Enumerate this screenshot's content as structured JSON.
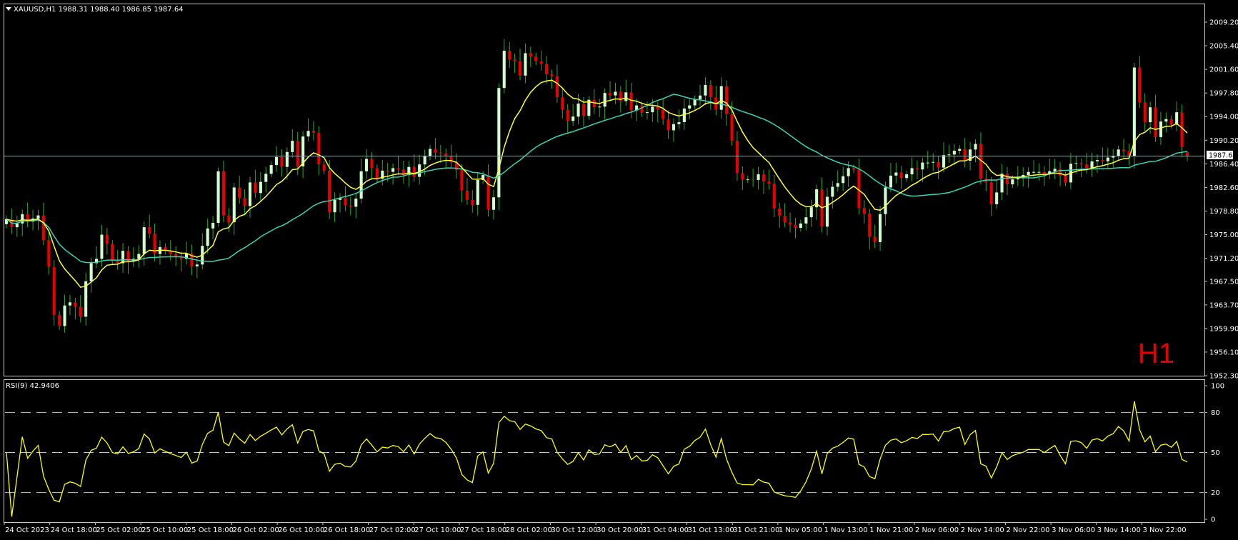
{
  "header": {
    "symbol_line": "XAUUSD,H1  1988.31 1988.40 1986.85 1987.64",
    "rsi_line": "RSI(9) 42.9406",
    "timeframe_badge": "H1",
    "current_price_label": "1987.64"
  },
  "colors": {
    "background": "#000000",
    "frame": "#c8c8c8",
    "bull_candle": "#d0ffd0",
    "bear_candle": "#e60000",
    "wick": "#2eaa2e",
    "fast_ma": "#ffff33",
    "slow_ma": "#33d6b4",
    "rsi_line": "#ffff00",
    "badge": "#e60000",
    "price_line": "#8fa3a3"
  },
  "chart_data": [
    {
      "type": "candlestick",
      "title": "XAUUSD,H1",
      "symbol": "XAUUSD",
      "timeframe": "H1",
      "last_bar": {
        "open": 1988.31,
        "high": 1988.4,
        "low": 1986.85,
        "close": 1987.64
      },
      "ylim": [
        1952.3,
        2011.5
      ],
      "y_ticks": [
        "2009.20",
        "2005.40",
        "2001.60",
        "1997.80",
        "1994.00",
        "1990.20",
        "1986.40",
        "1982.60",
        "1978.80",
        "1975.00",
        "1971.20",
        "1967.50",
        "1963.70",
        "1959.90",
        "1956.10",
        "1952.30"
      ],
      "x_ticks": [
        "24 Oct 2023",
        "24 Oct 18:00",
        "25 Oct 02:00",
        "25 Oct 10:00",
        "25 Oct 18:00",
        "26 Oct 02:00",
        "26 Oct 10:00",
        "26 Oct 18:00",
        "27 Oct 02:00",
        "27 Oct 10:00",
        "27 Oct 18:00",
        "28 Oct 02:00",
        "30 Oct 12:00",
        "30 Oct 20:00",
        "31 Oct 04:00",
        "31 Oct 13:00",
        "31 Oct 21:00",
        "1 Nov 05:00",
        "1 Nov 13:00",
        "1 Nov 21:00",
        "2 Nov 06:00",
        "2 Nov 14:00",
        "2 Nov 22:00",
        "3 Nov 06:00",
        "3 Nov 14:00",
        "3 Nov 22:00"
      ],
      "close": [
        1977.5,
        1976.2,
        1976.8,
        1978.3,
        1977.1,
        1977.6,
        1978.1,
        1974.1,
        1969.8,
        1962.1,
        1960.3,
        1963.6,
        1964.1,
        1963.4,
        1961.8,
        1967.5,
        1970.4,
        1971.1,
        1975.0,
        1973.5,
        1970.8,
        1970.4,
        1972.4,
        1970.7,
        1971.1,
        1971.9,
        1976.2,
        1975.2,
        1971.9,
        1973.0,
        1972.4,
        1971.9,
        1971.5,
        1971.1,
        1972.0,
        1969.9,
        1970.2,
        1973.2,
        1976.0,
        1976.9,
        1985.2,
        1978.1,
        1977.0,
        1982.6,
        1980.9,
        1979.6,
        1983.4,
        1981.7,
        1983.5,
        1984.8,
        1986.2,
        1987.5,
        1985.9,
        1988.3,
        1990.1,
        1986.0,
        1990.8,
        1991.7,
        1991.4,
        1986.3,
        1985.3,
        1978.6,
        1980.6,
        1980.9,
        1979.7,
        1979.5,
        1980.8,
        1985.2,
        1987.2,
        1985.7,
        1984.0,
        1985.3,
        1985.1,
        1985.7,
        1985.5,
        1984.6,
        1985.9,
        1984.3,
        1986.3,
        1987.6,
        1988.8,
        1988.2,
        1988.1,
        1987.6,
        1986.7,
        1985.4,
        1982.1,
        1980.6,
        1979.8,
        1983.8,
        1984.6,
        1979.0,
        1981.0,
        1998.6,
        2004.6,
        2003.2,
        2002.9,
        2000.6,
        2004.2,
        2003.7,
        2002.9,
        2002.5,
        2000.8,
        2000.5,
        1997.1,
        1995.1,
        1993.3,
        1994.0,
        1996.1,
        1994.1,
        1996.7,
        1995.5,
        1995.6,
        1997.8,
        1997.4,
        1998.0,
        1996.5,
        1997.9,
        1995.0,
        1995.8,
        1994.6,
        1994.7,
        1995.6,
        1995.1,
        1993.6,
        1991.8,
        1992.8,
        1993.1,
        1995.3,
        1995.8,
        1996.8,
        1997.4,
        1999.1,
        1997.1,
        1995.1,
        1998.9,
        1994.4,
        1990.1,
        1984.9,
        1983.9,
        1983.9,
        1983.8,
        1984.7,
        1983.6,
        1983.2,
        1979.2,
        1978.0,
        1977.0,
        1976.6,
        1976.1,
        1976.8,
        1977.8,
        1979.4,
        1982.3,
        1976.3,
        1981.1,
        1982.7,
        1983.3,
        1984.4,
        1985.7,
        1985.5,
        1979.3,
        1978.4,
        1974.7,
        1973.8,
        1978.3,
        1982.6,
        1984.5,
        1985.0,
        1984.1,
        1984.7,
        1985.7,
        1985.5,
        1986.6,
        1986.6,
        1986.7,
        1985.8,
        1987.8,
        1987.9,
        1988.5,
        1988.8,
        1986.9,
        1988.7,
        1989.6,
        1984.0,
        1983.4,
        1979.9,
        1981.8,
        1984.8,
        1983.1,
        1983.9,
        1984.3,
        1984.6,
        1985.1,
        1985.1,
        1985.1,
        1984.7,
        1985.2,
        1985.6,
        1984.5,
        1983.4,
        1986.4,
        1986.5,
        1986.3,
        1985.7,
        1986.8,
        1987.0,
        1986.8,
        1987.4,
        1987.7,
        1988.7,
        1988.4,
        1987.7,
        2001.9,
        1996.3,
        1993.1,
        1995.5,
        1990.7,
        1993.2,
        1993.6,
        1992.7,
        1994.7,
        1989.1,
        1987.6
      ],
      "rsi": {
        "name": "RSI(9)",
        "last": 42.9406,
        "ylim": [
          0,
          100
        ],
        "levels": [
          20,
          50,
          80
        ],
        "y_ticks": [
          "100",
          "80",
          "50",
          "20",
          "0"
        ]
      }
    }
  ]
}
